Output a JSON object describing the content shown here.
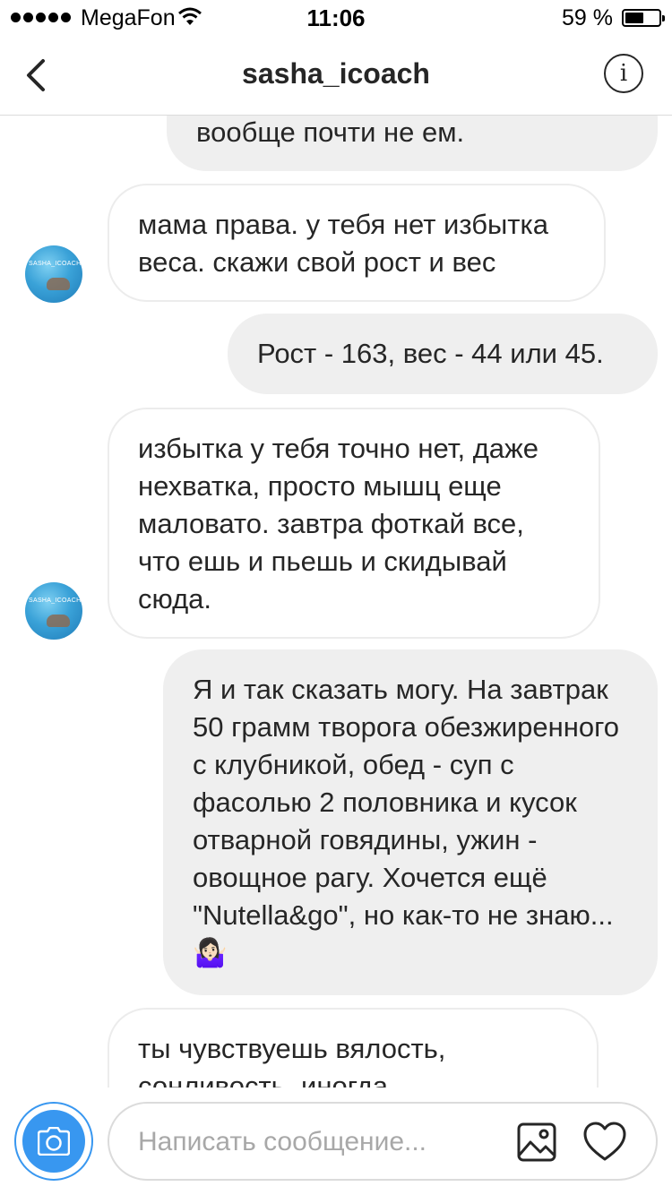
{
  "status_bar": {
    "carrier": "MegaFon",
    "time": "11:06",
    "battery": "59 %",
    "battery_level": 0.59
  },
  "header": {
    "title": "sasha_icoach"
  },
  "contact": {
    "avatar_text": "SASHA_ICOACH"
  },
  "messages": [
    {
      "sender": "me",
      "text": "вообще почти не ем."
    },
    {
      "sender": "sasha_icoach",
      "text": "мама права. у тебя нет избытка веса. скажи свой рост и вес"
    },
    {
      "sender": "me",
      "text": "Рост - 163, вес - 44 или 45."
    },
    {
      "sender": "sasha_icoach",
      "text": "избытка у тебя точно нет, даже нехватка, просто мышц еще маловато. завтра фоткай все, что ешь и пьешь и скидывай сюда."
    },
    {
      "sender": "me",
      "text": "Я и так сказать могу. На завтрак 50 грамм творога обезжиренного с клубникой, обед - суп с фасолью 2 половника и кусок отварной говядины, ужин - овощное рагу. Хочется ещё \"Nutella&go\", но как-то не знаю...🤷🏻‍♀️"
    },
    {
      "sender": "sasha_icoach",
      "text": "ты чувствуешь вялость, сонливость, иногда"
    }
  ],
  "composer": {
    "placeholder": "Написать сообщение...",
    "value": ""
  },
  "icons": {
    "back": "chevron-left-icon",
    "info": "info-icon",
    "camera": "camera-icon",
    "gallery": "image-icon",
    "like": "heart-icon"
  },
  "colors": {
    "accent": "#3897f0",
    "outgoing_bubble": "#efefef",
    "incoming_border": "#ececec",
    "text": "#262626",
    "placeholder": "#a8a8a8"
  }
}
